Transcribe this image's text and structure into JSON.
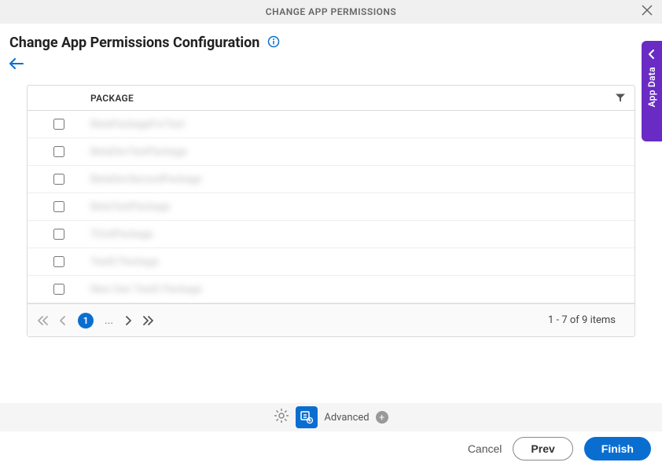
{
  "header": {
    "title": "CHANGE APP PERMISSIONS"
  },
  "page": {
    "title": "Change App Permissions Configuration"
  },
  "side_tab": {
    "label": "App Data"
  },
  "table": {
    "column_label": "PACKAGE",
    "rows": [
      {
        "text": "BetaPackageForTest"
      },
      {
        "text": "BetaDevTestPackage"
      },
      {
        "text": "BetaDevSecondPackage"
      },
      {
        "text": "BetaTestPackage"
      },
      {
        "text": "ThirdPackage"
      },
      {
        "text": "TestD Package"
      },
      {
        "text": "New Gen TestD Package"
      }
    ]
  },
  "pagination": {
    "current": "1",
    "ellipsis": "...",
    "info": "1 - 7 of 9 items"
  },
  "toolbar": {
    "advanced_label": "Advanced"
  },
  "footer": {
    "cancel": "Cancel",
    "prev": "Prev",
    "finish": "Finish"
  }
}
